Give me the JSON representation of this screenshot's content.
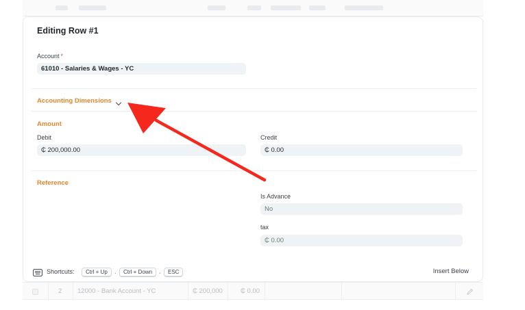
{
  "background_rows": {
    "bottom_row": {
      "index": "2",
      "account": "12000 - Bank Account - YC",
      "debit": "₵ 200,000",
      "credit": "₵ 0.00"
    }
  },
  "panel": {
    "title": "Editing Row #1",
    "account": {
      "label": "Account",
      "required_mark": "*",
      "value": "61010 - Salaries & Wages - YC"
    },
    "accounting_dimensions": {
      "label": "Accounting Dimensions"
    },
    "amount": {
      "section_label": "Amount",
      "debit_label": "Debit",
      "debit_value": "₵ 200,000.00",
      "credit_label": "Credit",
      "credit_value": "₵ 0.00"
    },
    "reference": {
      "section_label": "Reference",
      "is_advance_label": "Is Advance",
      "is_advance_value": "No",
      "tax_label": "tax",
      "tax_value": "₵ 0.00"
    },
    "footer": {
      "shortcuts_label": "Shortcuts:",
      "shortcut_1": "Ctrl + Up",
      "shortcut_2": "Ctrl + Down",
      "shortcut_3": "ESC",
      "separator": ".",
      "insert_below_label": "Insert Below"
    }
  },
  "colors": {
    "section_heading": "#e8862e",
    "field_background": "#f0f3f6",
    "required_mark": "#e24c4c",
    "annotation_arrow": "#f5281e"
  },
  "icons": {
    "accounting_dimensions_toggle": "chevron-down-icon",
    "shortcuts": "keyboard-icon",
    "row_edit": "pencil-icon",
    "annotation": "red-arrow-pointer"
  }
}
